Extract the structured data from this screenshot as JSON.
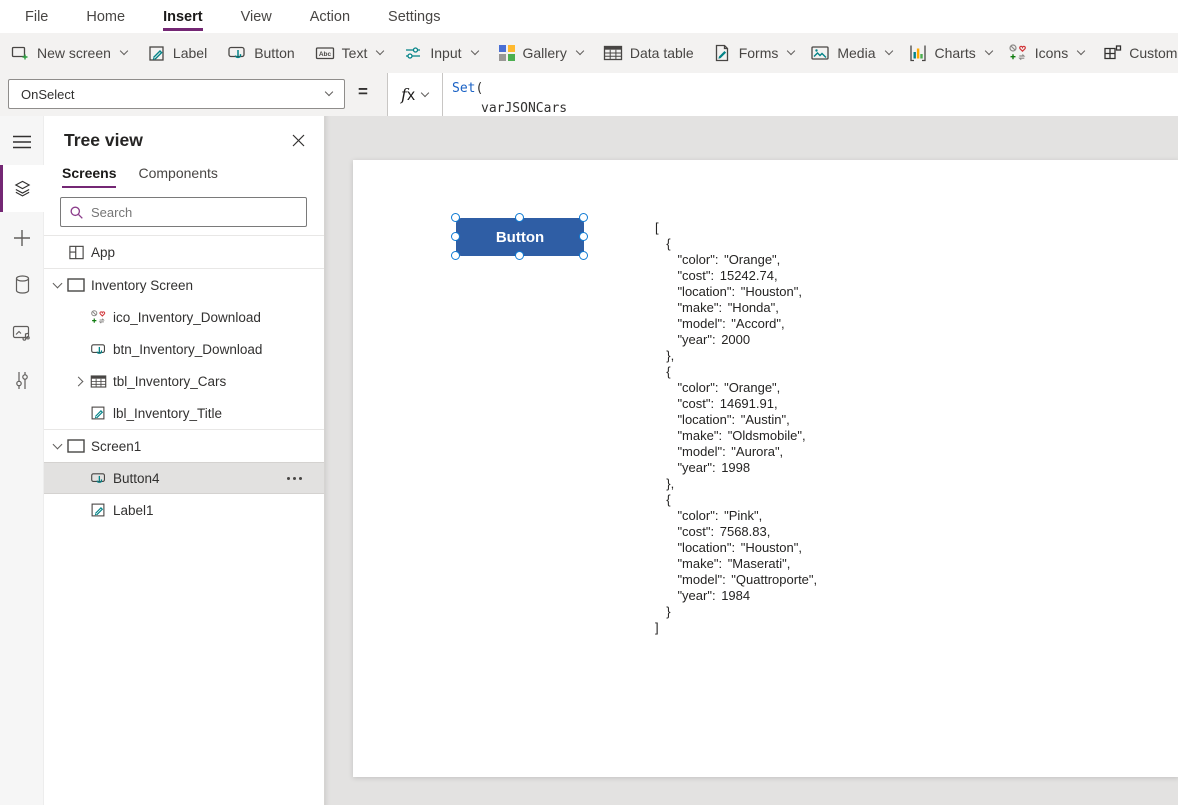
{
  "menubar": {
    "items": [
      {
        "label": "File"
      },
      {
        "label": "Home"
      },
      {
        "label": "Insert",
        "active": true
      },
      {
        "label": "View"
      },
      {
        "label": "Action"
      },
      {
        "label": "Settings"
      }
    ]
  },
  "toolbar": {
    "new_screen": "New screen",
    "label": "Label",
    "button": "Button",
    "text": "Text",
    "text_icon_glyph": "Abc",
    "input": "Input",
    "gallery": "Gallery",
    "data_table": "Data table",
    "forms": "Forms",
    "media": "Media",
    "charts": "Charts",
    "icons": "Icons",
    "custom": "Custom"
  },
  "formula_bar": {
    "property": "OnSelect",
    "equals": "=",
    "fx_label": "x",
    "fx_f": "f",
    "code_fn": "Set",
    "code_paren": "(",
    "code_line2": "varJSONCars"
  },
  "tree_panel": {
    "title": "Tree view",
    "tabs": {
      "screens": "Screens",
      "components": "Components"
    },
    "search_placeholder": "Search",
    "rows": [
      {
        "label": "App"
      },
      {
        "label": "Inventory Screen"
      },
      {
        "label": "ico_Inventory_Download"
      },
      {
        "label": "btn_Inventory_Download"
      },
      {
        "label": "tbl_Inventory_Cars"
      },
      {
        "label": "lbl_Inventory_Title"
      },
      {
        "label": "Screen1"
      },
      {
        "label": "Button4",
        "selected": true
      },
      {
        "label": "Label1"
      }
    ]
  },
  "canvas": {
    "button_label": "Button",
    "json_label": "[\n  {\n    \"color\": \"Orange\",\n    \"cost\": 15242.74,\n    \"location\": \"Houston\",\n    \"make\": \"Honda\",\n    \"model\": \"Accord\",\n    \"year\": 2000\n  },\n  {\n    \"color\": \"Orange\",\n    \"cost\": 14691.91,\n    \"location\": \"Austin\",\n    \"make\": \"Oldsmobile\",\n    \"model\": \"Aurora\",\n    \"year\": 1998\n  },\n  {\n    \"color\": \"Pink\",\n    \"cost\": 7568.83,\n    \"location\": \"Houston\",\n    \"make\": \"Maserati\",\n    \"model\": \"Quattroporte\",\n    \"year\": 1984\n  }\n]"
  },
  "colors": {
    "accent_purple": "#742774",
    "button_fill": "#2f5ea5",
    "handle_blue": "#0f7bd4",
    "icon_teal": "#038387",
    "formula_fn_blue": "#1a62c5"
  }
}
